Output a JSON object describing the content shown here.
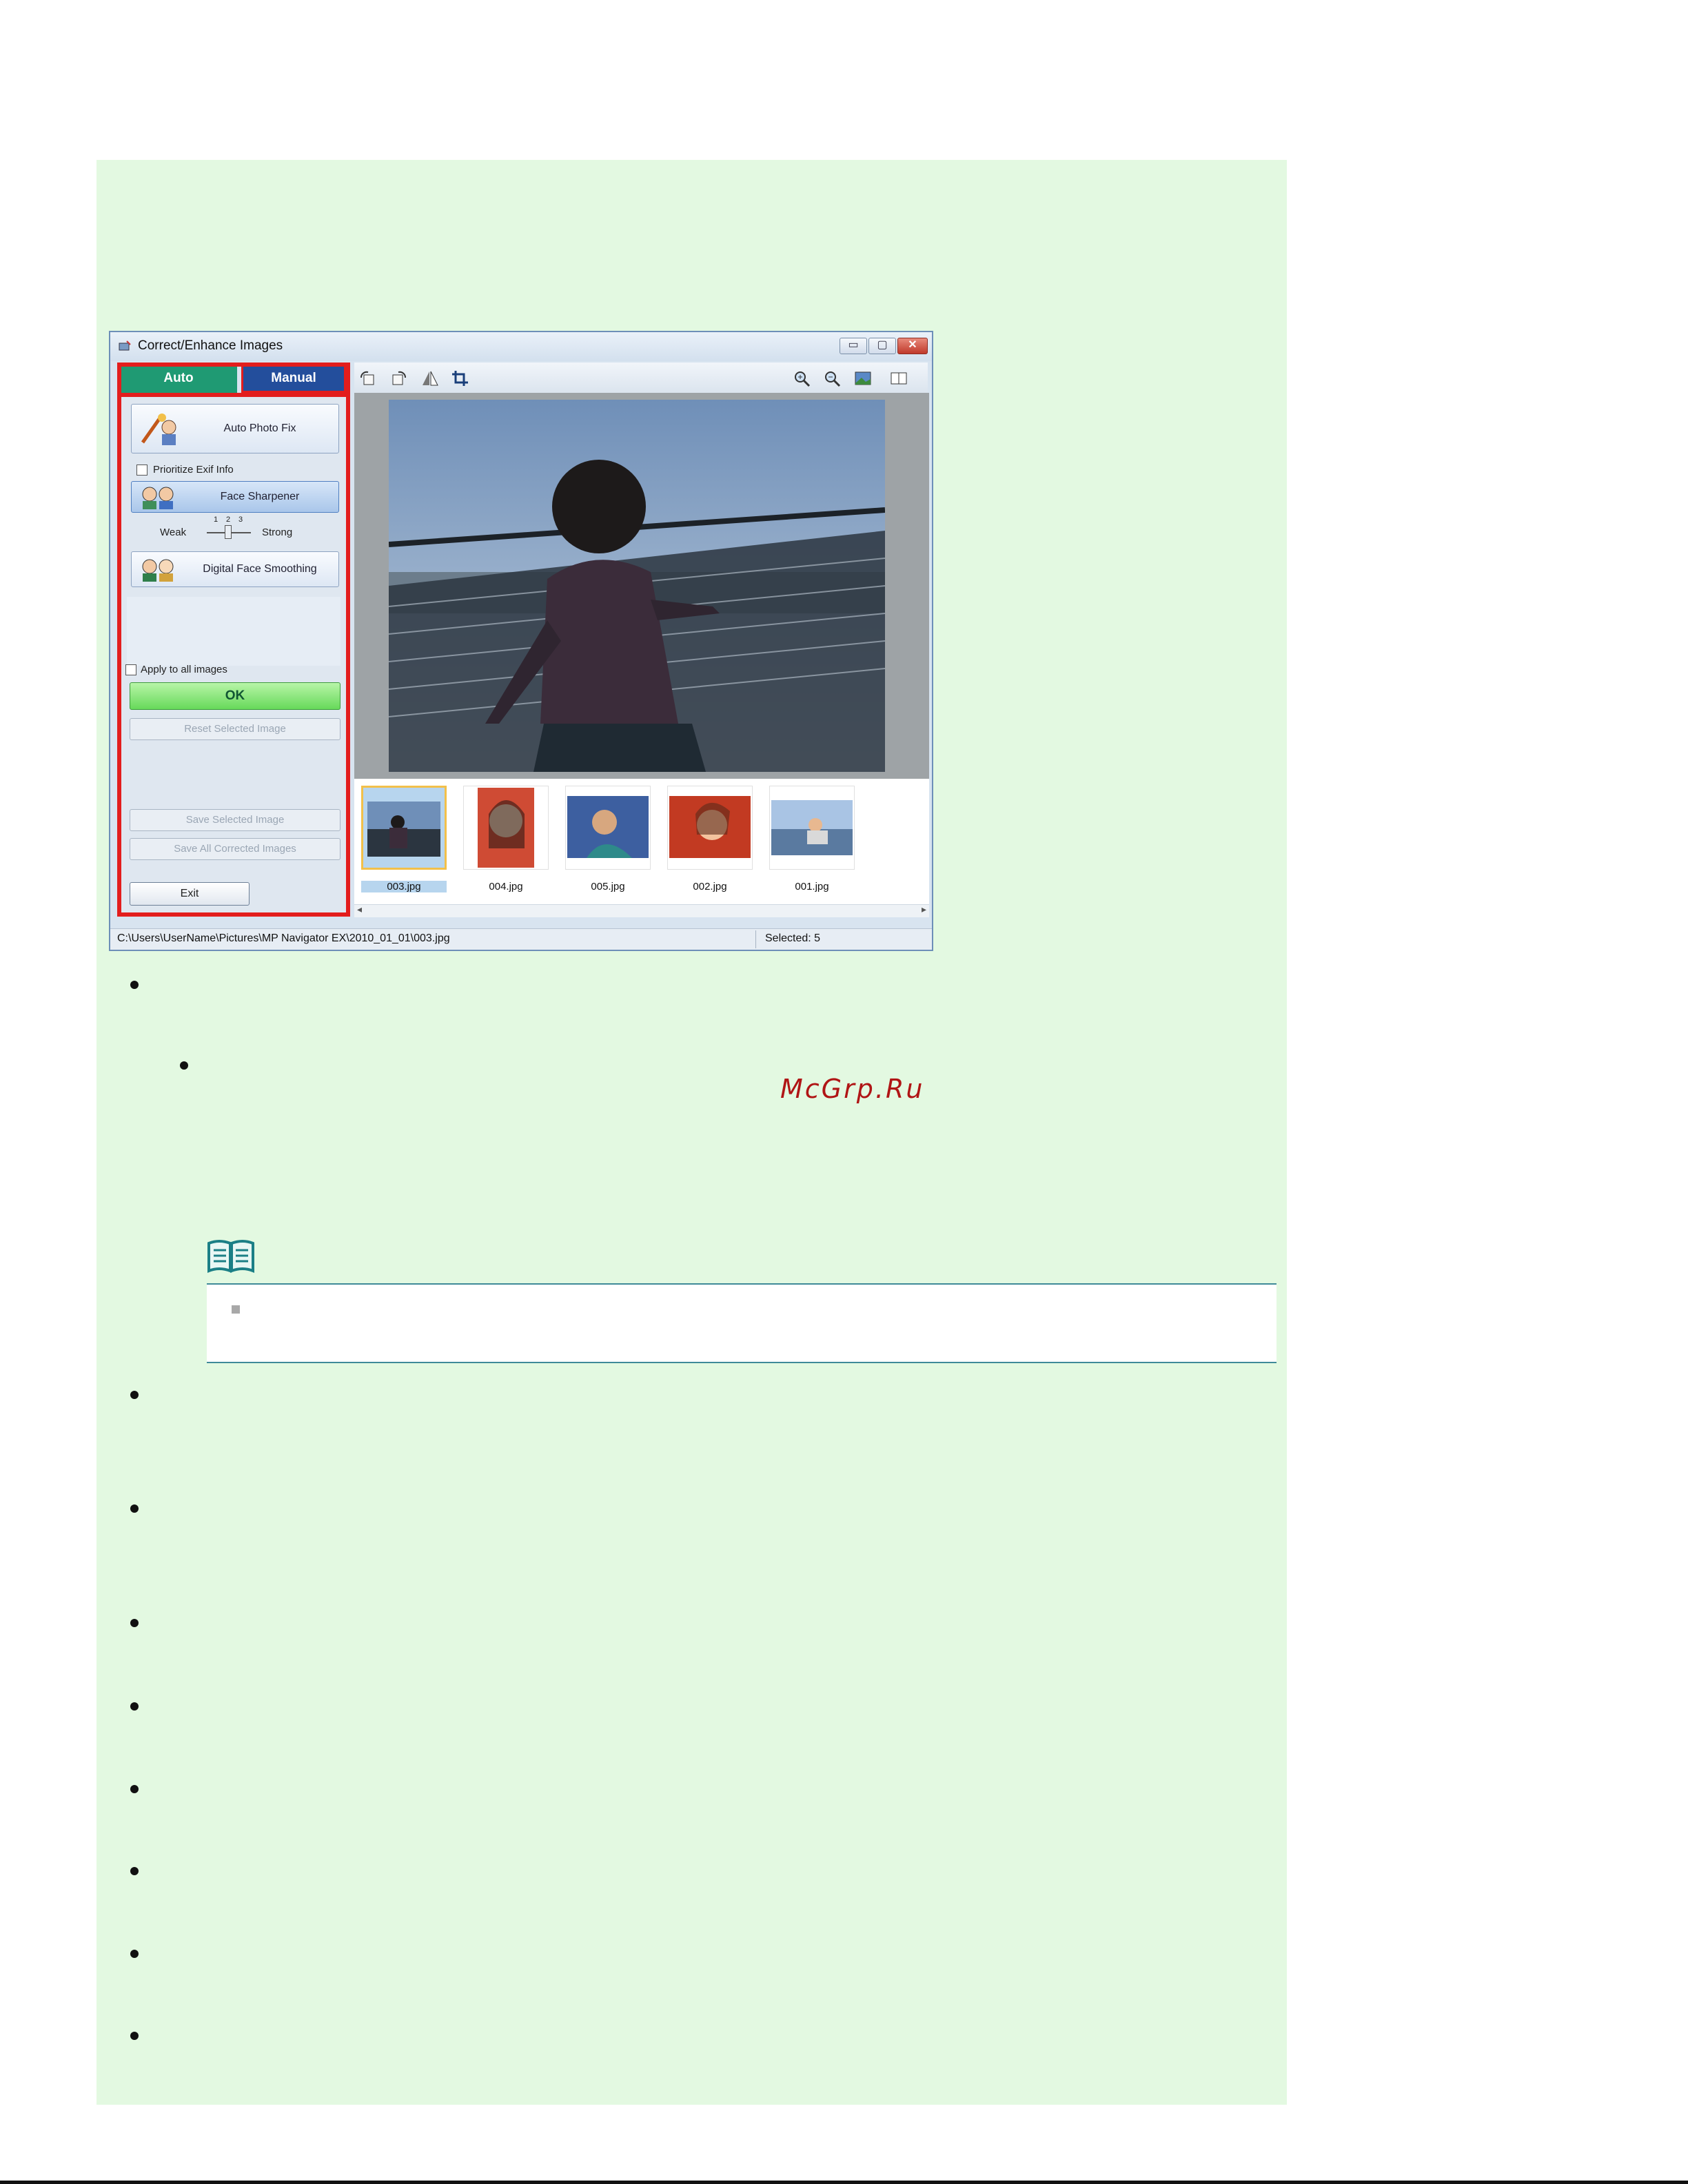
{
  "window": {
    "title": "Correct/Enhance Images",
    "tabs": {
      "auto": "Auto",
      "manual": "Manual"
    },
    "auto_panel": {
      "auto_photo_fix": "Auto Photo Fix",
      "prioritize_exif": "Prioritize Exif Info",
      "face_sharpener": "Face Sharpener",
      "slider_weak": "Weak",
      "slider_strong": "Strong",
      "slider_ticks": [
        "1",
        "2",
        "3"
      ],
      "slider_value": 2,
      "digital_face_smoothing": "Digital Face Smoothing",
      "apply_to_all": "Apply to all images",
      "ok": "OK",
      "reset_selected": "Reset Selected Image",
      "save_selected": "Save Selected Image",
      "save_all": "Save All Corrected Images",
      "exit": "Exit"
    },
    "toolbar_icons": [
      "rotate-left-icon",
      "rotate-right-icon",
      "invert-icon",
      "crop-icon",
      "zoom-in-icon",
      "zoom-out-icon",
      "whole-image-icon",
      "compare-icon"
    ],
    "thumbnails": [
      {
        "name": "003.jpg",
        "selected": true
      },
      {
        "name": "004.jpg",
        "selected": false
      },
      {
        "name": "005.jpg",
        "selected": false
      },
      {
        "name": "002.jpg",
        "selected": false
      },
      {
        "name": "001.jpg",
        "selected": false
      }
    ],
    "status": {
      "path": "C:\\Users\\UserName\\Pictures\\MP Navigator EX\\2010_01_01\\003.jpg",
      "selected": "Selected: 5"
    },
    "caption_buttons": {
      "minimize": "▭",
      "maximize": "▢",
      "close": "✕"
    }
  },
  "watermark": "McGrp.Ru",
  "colors": {
    "panel_bg": "#e3f9e1",
    "highlight_red": "#e31d1d",
    "auto_tab": "#1f9a73",
    "manual_tab": "#234e9c",
    "ok_green": "#67d95a"
  }
}
